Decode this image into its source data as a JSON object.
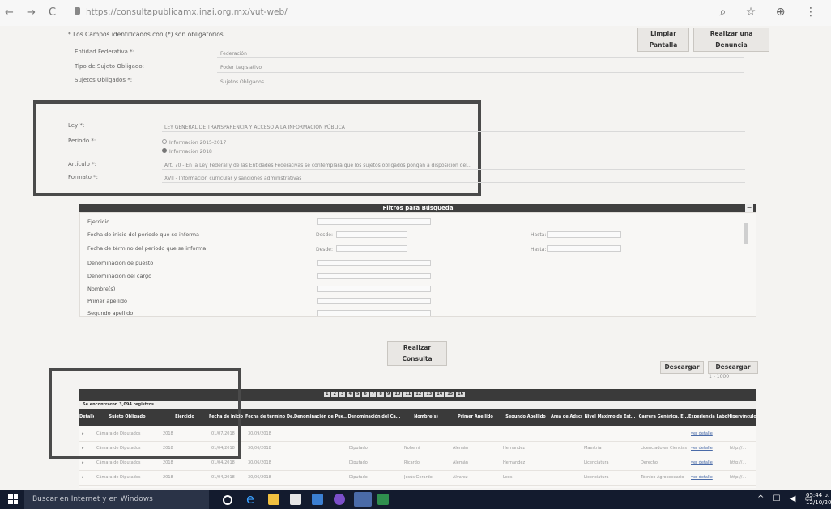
{
  "browser": {
    "url": "https://consultapublicamx.inai.org.mx/vut-web/",
    "nav": "← → C",
    "tools": "⌕ ☆ ⊕ ⋮"
  },
  "form": {
    "required_note": "* Los Campos identificados con (*) son obligatorios",
    "clear_label": "Limpiar Pantalla",
    "report_label": "Realizar una Denuncia",
    "entidad_label": "Entidad Federativa *:",
    "entidad_value": "Federación",
    "tipo_label": "Tipo de Sujeto Obligado:",
    "tipo_value": "Poder Legislativo",
    "sujetos_label": "Sujetos Obligados *:",
    "sujetos_value": "Sujetos Obligados",
    "ley_label": "Ley *:",
    "ley_value": "LEY GENERAL DE TRANSPARENCIA Y ACCESO A LA INFORMACIÓN PÚBLICA",
    "periodo_label": "Periodo *:",
    "periodo_opt1": "Información 2015-2017",
    "periodo_opt2": "Información 2018",
    "articulo_label": "Artículo *:",
    "articulo_value": "Art. 70 - En la Ley Federal y de las Entidades Federativas se contemplará que los sujetos obligados pongan a disposición del...",
    "formato_label": "Formato *:",
    "formato_value": "XVII - Información curricular y sanciones administrativas"
  },
  "filters": {
    "title": "Filtros para Búsqueda",
    "close": "−",
    "items": [
      "Ejercicio",
      "Fecha de inicio del periodo que se informa",
      "Fecha de término del periodo que se informa",
      "Denominación de puesto",
      "Denominación del cargo",
      "Nombre(s)",
      "Primer apellido",
      "Segundo apellido"
    ],
    "desde": "Desde:",
    "hasta": "Hasta:"
  },
  "query_label": "Realizar Consulta",
  "download": {
    "btn1": "Descargar",
    "btn2": "Descargar",
    "range": "1 - 1000"
  },
  "results": {
    "found": "Se encontraron 3,094 registros.",
    "pages": [
      "1",
      "2",
      "3",
      "4",
      "5",
      "6",
      "7",
      "8",
      "9",
      "10",
      "11",
      "12",
      "13",
      "14",
      "15",
      "16"
    ],
    "headers": [
      "Detalle",
      "Sujeto Obligado",
      "Ejercicio",
      "Fecha de inicio D...",
      "Fecha de término De...",
      "Denominación de Pue...",
      "Denominación del Ca...",
      "Nombre(s)",
      "Primer Apellido",
      "Segundo Apellido",
      "Área de Adscripción",
      "Nivel Máximo de Est...",
      "Carrera Genérica, E...",
      "Experiencia Laboral",
      "Hipervínculo"
    ],
    "rows": [
      [
        "▸",
        "Cámara de Diputados",
        "2018",
        "01/07/2018",
        "30/09/2018",
        "",
        "",
        "",
        "",
        "",
        "",
        "",
        "",
        "ver detalle",
        ""
      ],
      [
        "▸",
        "Cámara de Diputados",
        "2018",
        "01/04/2018",
        "30/06/2018",
        "",
        "Diputado",
        "Nohemí",
        "Alemán",
        "Hernández",
        "",
        "Maestría",
        "Licenciado en Ciencias",
        "ver detalle",
        "http://..."
      ],
      [
        "▸",
        "Cámara de Diputados",
        "2018",
        "01/04/2018",
        "30/06/2018",
        "",
        "Diputado",
        "Ricardo",
        "Alemán",
        "Hernández",
        "",
        "Licenciatura",
        "Derecho",
        "ver detalle",
        "http://..."
      ],
      [
        "▸",
        "Cámara de Diputados",
        "2018",
        "01/04/2018",
        "30/06/2018",
        "",
        "Diputado",
        "Jesús Gerardo",
        "Alvarez",
        "Leos",
        "",
        "Licenciatura",
        "Técnico Agropecuario",
        "ver detalle",
        "http://..."
      ]
    ]
  },
  "taskbar": {
    "search": "Buscar en Internet y en Windows",
    "time": "05:44 p. m.",
    "date": "12/10/2018"
  }
}
